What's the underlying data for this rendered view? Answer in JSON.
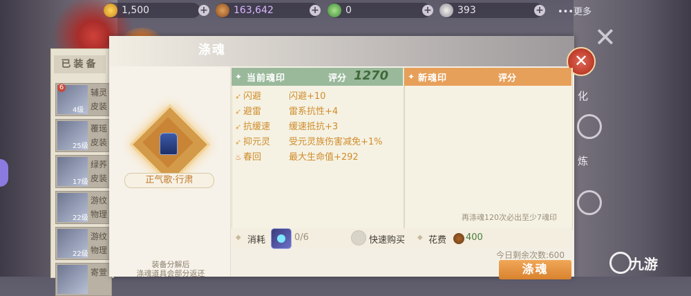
{
  "topbar": {
    "currencies": [
      {
        "icon": "gold-ingot-icon",
        "value": "1,500"
      },
      {
        "icon": "copper-coin-bag-icon",
        "value": "163,642"
      },
      {
        "icon": "jade-token-icon",
        "value": "0"
      },
      {
        "icon": "silver-token-icon",
        "value": "393"
      }
    ],
    "more_label": "•••更多"
  },
  "equipped": {
    "tab_label": "已装备",
    "items": [
      {
        "badge": "6",
        "level": "4级",
        "name_top": "辅灵",
        "name_bottom": "皮装"
      },
      {
        "badge": "",
        "level": "25级",
        "name_top": "覆瑶",
        "name_bottom": "皮装"
      },
      {
        "badge": "",
        "level": "17级",
        "name_top": "绿荞",
        "name_bottom": "皮装"
      },
      {
        "badge": "",
        "level": "22级",
        "name_top": "游纹",
        "name_bottom": "物理"
      },
      {
        "badge": "",
        "level": "22级",
        "name_top": "游纹",
        "name_bottom": "物理"
      },
      {
        "badge": "",
        "level": "",
        "name_top": "寄萱",
        "name_bottom": ""
      }
    ]
  },
  "dialog": {
    "title": "涤魂",
    "close_icon": "close-icon",
    "item_name": "正气歌·行肃",
    "decompose_hint_line1": "装备分解后",
    "decompose_hint_line2": "涤魂道具会部分返还"
  },
  "current_soul": {
    "title": "当前魂印",
    "score_label": "评分",
    "score": "1270",
    "attributes": [
      {
        "name": "闪避",
        "value": "闪避+10"
      },
      {
        "name": "避雷",
        "value": "雷系抗性+4"
      },
      {
        "name": "抗缓速",
        "value": "缓速抵抗+3"
      },
      {
        "name": "抑元灵",
        "value": "受元灵族伤害减免+1%"
      },
      {
        "name": "春回",
        "value": "最大生命值+292"
      }
    ]
  },
  "new_soul": {
    "title": "新魂印",
    "score_label": "评分",
    "guarantee_hint": "再涤魂120次必出至少7魂印"
  },
  "cost": {
    "consume_label": "消耗",
    "consume_value": "0/6",
    "quick_buy_label": "快速购买",
    "fee_label": "花费",
    "fee_value": "400",
    "remaining_label": "今日剩余次数:600",
    "wash_button": "涤魂"
  },
  "side_menu": [
    "化",
    "炼"
  ],
  "watermark": "九游",
  "colors": {
    "current_header": "#9ab99b",
    "new_header": "#e7a05a",
    "attr_text": "#d08c2a",
    "score_value": "#3f6a3a",
    "button": "#e38f3c"
  }
}
